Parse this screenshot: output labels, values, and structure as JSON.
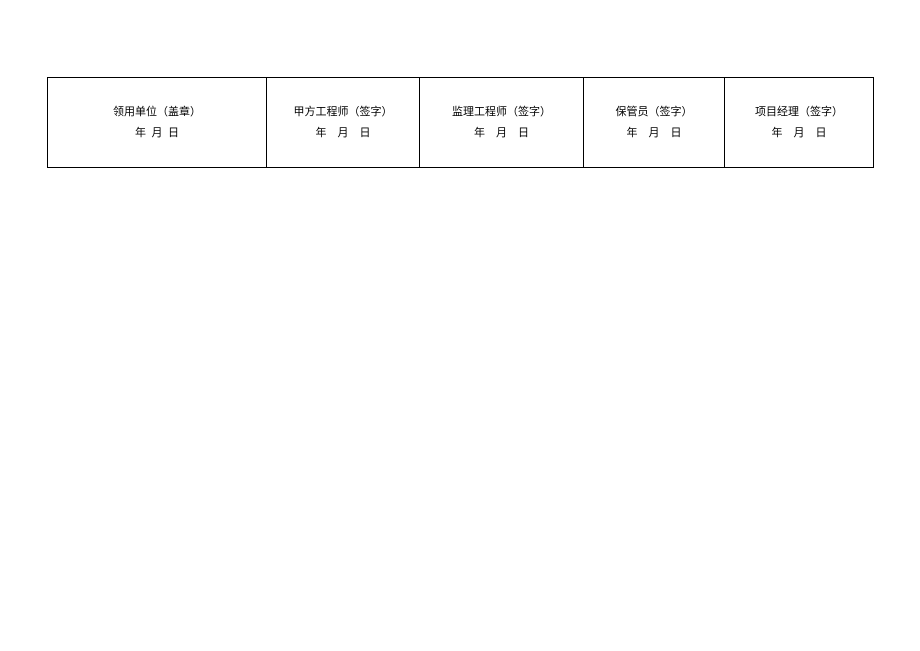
{
  "signatures": {
    "cells": [
      {
        "title": "领用单位（盖章）",
        "date": "年  月  日"
      },
      {
        "title": "甲方工程师（签字）",
        "date": "年    月    日"
      },
      {
        "title": "监理工程师（签字）",
        "date": "年    月    日"
      },
      {
        "title": "保管员（签字）",
        "date": "年    月    日"
      },
      {
        "title": "项目经理（签字）",
        "date": "年    月    日"
      }
    ]
  }
}
